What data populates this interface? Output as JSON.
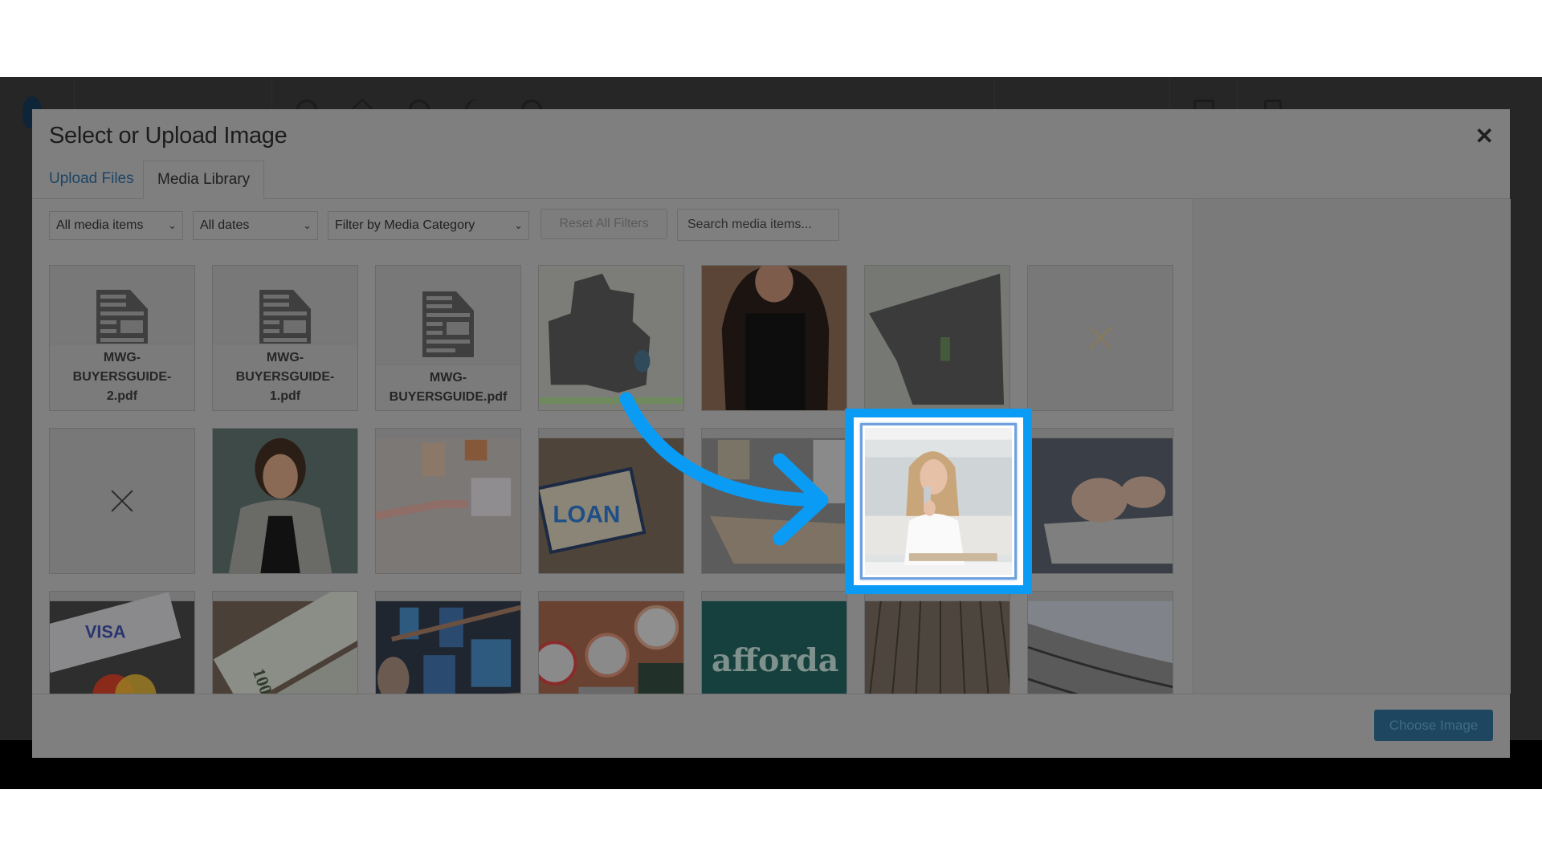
{
  "modal": {
    "title": "Select or Upload Image",
    "close_icon": "close-icon",
    "tabs": [
      {
        "label": "Upload Files",
        "active": false
      },
      {
        "label": "Media Library",
        "active": true
      }
    ]
  },
  "toolbar": {
    "media_type_select": "All media items",
    "date_select": "All dates",
    "category_select": "Filter by Media Category",
    "reset_label": "Reset All Filters",
    "search_placeholder": "Search media items..."
  },
  "grid": {
    "items": [
      {
        "type": "pdf",
        "label": "MWG-BUYERSGUIDE-2.pdf",
        "caption_lines": [
          "MWG-",
          "BUYERSGUIDE-",
          "2.pdf"
        ]
      },
      {
        "type": "pdf",
        "label": "MWG-BUYERSGUIDE-1.pdf",
        "caption_lines": [
          "MWG-",
          "BUYERSGUIDE-",
          "1.pdf"
        ]
      },
      {
        "type": "pdf",
        "label": "MWG-BUYERSGUIDE.pdf",
        "caption_lines": [
          "MWG-",
          "BUYERSGUIDE.pdf"
        ]
      },
      {
        "type": "image",
        "label": "county map"
      },
      {
        "type": "image",
        "label": "woman with long dark hair"
      },
      {
        "type": "image",
        "label": "neighborhood map"
      },
      {
        "type": "broken",
        "label": "missing image"
      },
      {
        "type": "broken",
        "label": "missing image"
      },
      {
        "type": "image",
        "label": "smiling woman portrait"
      },
      {
        "type": "image",
        "label": "handshake with clipboard"
      },
      {
        "type": "image",
        "label": "loan clipboard",
        "overlay_text": "LOAN"
      },
      {
        "type": "image",
        "label": "box of office items"
      },
      {
        "type": "image",
        "label": "woman holding credit card",
        "selected": true
      },
      {
        "type": "image",
        "label": "hand signing document"
      },
      {
        "type": "image",
        "label": "credit cards",
        "overlay_text": "VISA"
      },
      {
        "type": "image",
        "label": "100 dollar bills",
        "overlay_text": "100"
      },
      {
        "type": "image",
        "label": "man looking at TV wall"
      },
      {
        "type": "image",
        "label": "people holding emoji faces"
      },
      {
        "type": "image",
        "label": "affordable chalkboard",
        "overlay_text": "afforda"
      },
      {
        "type": "image",
        "label": "wooden deck"
      },
      {
        "type": "image",
        "label": "shingled roof"
      }
    ]
  },
  "footer": {
    "choose_label": "Choose Image"
  },
  "annotation": {
    "highlight_color": "#0a9bf5",
    "arrow_color": "#0a9bf5",
    "target": "woman holding credit card"
  }
}
